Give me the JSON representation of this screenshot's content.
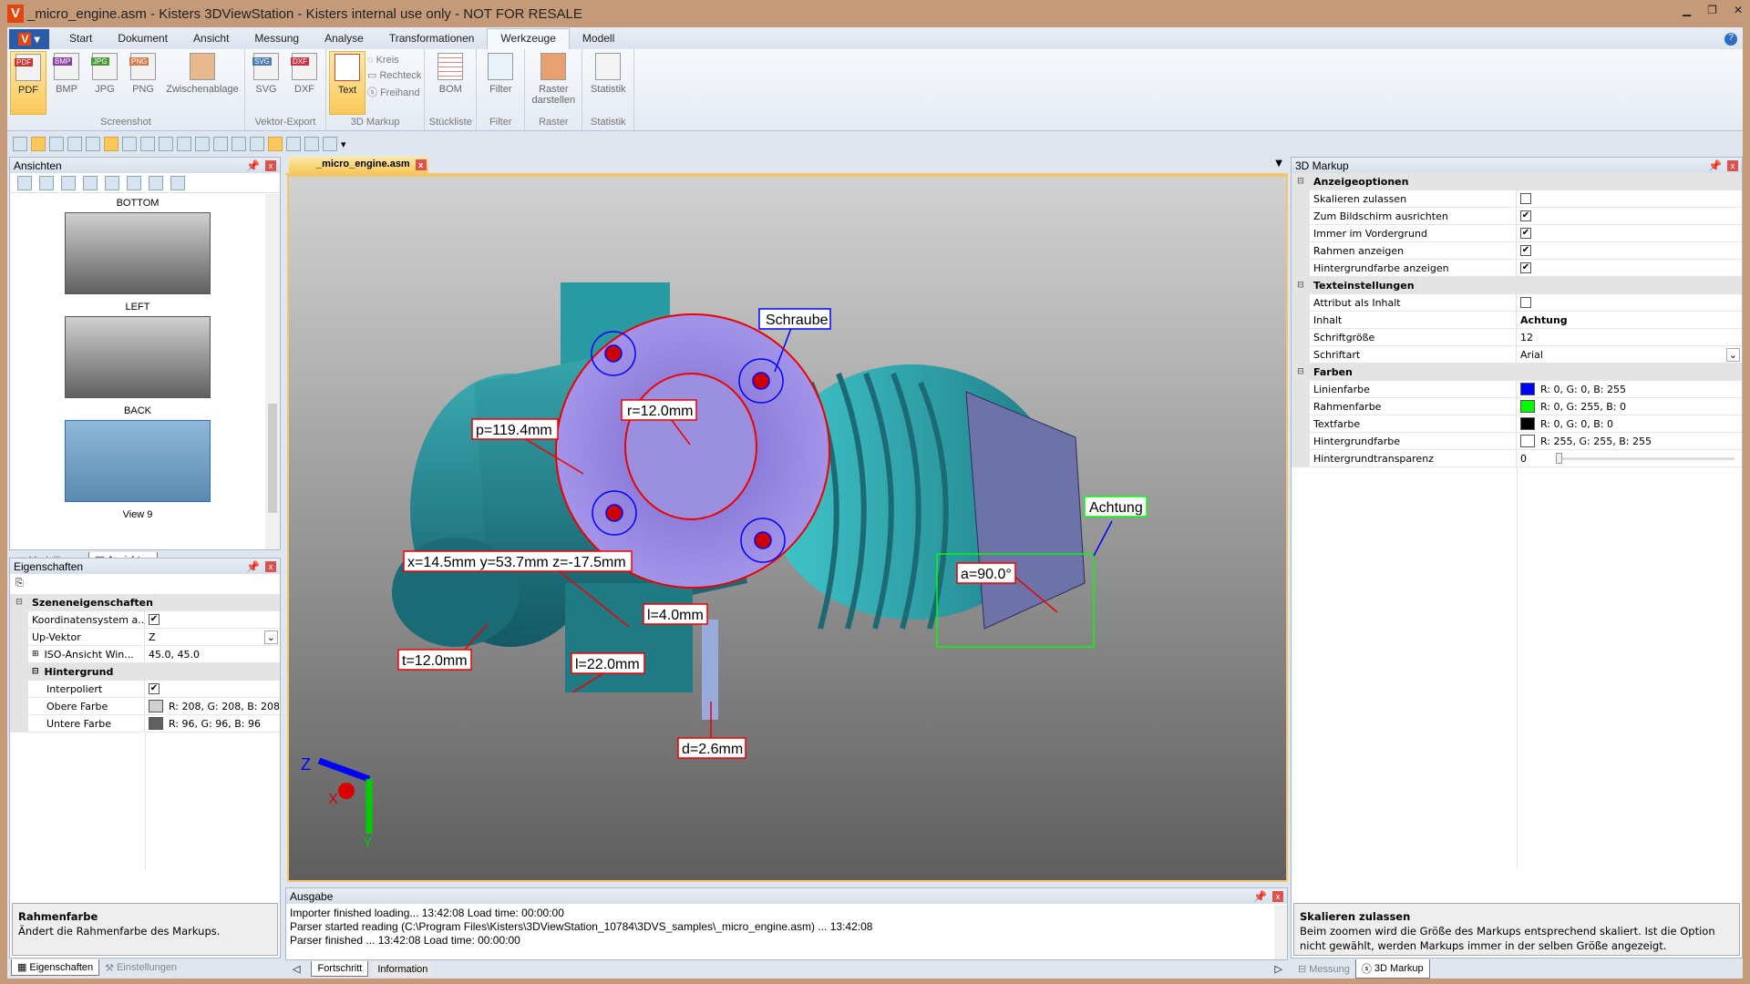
{
  "window": {
    "title": "_micro_engine.asm - Kisters 3DViewStation - Kisters internal use only - NOT FOR RESALE",
    "logo": "V"
  },
  "menu": {
    "app_button": "V",
    "tabs": [
      "Start",
      "Dokument",
      "Ansicht",
      "Messung",
      "Analyse",
      "Transformationen",
      "Werkzeuge",
      "Modell"
    ],
    "active": "Werkzeuge"
  },
  "ribbon": {
    "screenshot": {
      "label": "Screenshot",
      "items": [
        "PDF",
        "BMP",
        "JPG",
        "PNG",
        "Zwischenablage"
      ]
    },
    "vektor": {
      "label": "Vektor-Export",
      "items": [
        "SVG",
        "DXF"
      ]
    },
    "markup": {
      "label": "3D Markup",
      "text": "Text",
      "kreis": "Kreis",
      "rechteck": "Rechteck",
      "freihand": "Freihand"
    },
    "stueckliste": {
      "label": "Stückliste",
      "item": "BOM"
    },
    "filter": {
      "label": "Filter",
      "item": "Filter"
    },
    "raster": {
      "label": "Raster",
      "item": "Raster darstellen"
    },
    "statistik": {
      "label": "Statistik",
      "item": "Statistik"
    }
  },
  "ansichten": {
    "title": "Ansichten",
    "views": [
      "BOTTOM",
      "LEFT",
      "BACK",
      "View 9"
    ],
    "tabs": [
      "Modellbaum",
      "Ansichten"
    ]
  },
  "eigenschaften": {
    "title": "Eigenschaften",
    "section1": "Szeneneigenschaften",
    "rows": [
      {
        "k": "Koordinatensystem a...",
        "v": "checked"
      },
      {
        "k": "Up-Vektor",
        "v": "Z"
      },
      {
        "k": "ISO-Ansicht Win...",
        "v": "45.0, 45.0"
      }
    ],
    "section2": "Hintergrund",
    "rows2": [
      {
        "k": "Interpoliert",
        "v": "checked"
      },
      {
        "k": "Obere Farbe",
        "v": "R: 208, G: 208, B: 208",
        "color": "#d0d0d0"
      },
      {
        "k": "Untere Farbe",
        "v": "R: 96, G: 96, B: 96",
        "color": "#606060"
      }
    ],
    "desc_title": "Rahmenfarbe",
    "desc_text": "Ändert die Rahmenfarbe des Markups.",
    "tabs": [
      "Eigenschaften",
      "Einstellungen"
    ]
  },
  "document": {
    "tab": "_micro_engine.asm"
  },
  "viewport": {
    "labels": [
      "Schraube",
      "r=12.0mm",
      "p=119.4mm",
      "Achtung",
      "a=90.0°",
      "x=14.5mm y=53.7mm z=-17.5mm",
      "l=4.0mm",
      "t=12.0mm",
      "l=22.0mm",
      "d=2.6mm"
    ],
    "axes": {
      "z": "Z",
      "x": "X",
      "y": "Y"
    }
  },
  "output": {
    "title": "Ausgabe",
    "lines": [
      "Importer finished loading... 13:42:08 Load time: 00:00:00",
      "Parser started reading (C:\\Program Files\\Kisters\\3DViewStation_10784\\3DVS_samples\\_micro_engine.asm) ... 13:42:08",
      "Parser finished ... 13:42:08 Load time: 00:00:00"
    ],
    "tabs": [
      "Fortschritt",
      "Information"
    ]
  },
  "markup_panel": {
    "title": "3D Markup",
    "sections": [
      {
        "name": "Anzeigeoptionen",
        "rows": [
          {
            "k": "Skalieren zulassen",
            "type": "cb",
            "v": false
          },
          {
            "k": "Zum Bildschirm ausrichten",
            "type": "cb",
            "v": true
          },
          {
            "k": "Immer im Vordergrund",
            "type": "cb",
            "v": true
          },
          {
            "k": "Rahmen anzeigen",
            "type": "cb",
            "v": true
          },
          {
            "k": "Hintergrundfarbe anzeigen",
            "type": "cb",
            "v": true
          }
        ]
      },
      {
        "name": "Texteinstellungen",
        "rows": [
          {
            "k": "Attribut als Inhalt",
            "type": "cb",
            "v": false
          },
          {
            "k": "Inhalt",
            "type": "bold",
            "v": "Achtung"
          },
          {
            "k": "Schriftgröße",
            "type": "text",
            "v": "12"
          },
          {
            "k": "Schriftart",
            "type": "select",
            "v": "Arial"
          }
        ]
      },
      {
        "name": "Farben",
        "rows": [
          {
            "k": "Linienfarbe",
            "type": "color",
            "v": "R: 0, G: 0, B: 255",
            "color": "#0000ff"
          },
          {
            "k": "Rahmenfarbe",
            "type": "color",
            "v": "R: 0, G: 255, B: 0",
            "color": "#00ff00"
          },
          {
            "k": "Textfarbe",
            "type": "color",
            "v": "R: 0, G: 0, B: 0",
            "color": "#000000"
          },
          {
            "k": "Hintergrundfarbe",
            "type": "color",
            "v": "R: 255, G: 255, B: 255",
            "color": "#ffffff"
          },
          {
            "k": "Hintergrundtransparenz",
            "type": "slider",
            "v": "0"
          }
        ]
      }
    ],
    "desc_title": "Skalieren zulassen",
    "desc_text": "Beim zoomen wird die Größe des Markups entsprechend skaliert. Ist die Option nicht gewählt, werden Markups immer in der selben Größe angezeigt.",
    "tabs": [
      "Messung",
      "3D Markup"
    ]
  }
}
